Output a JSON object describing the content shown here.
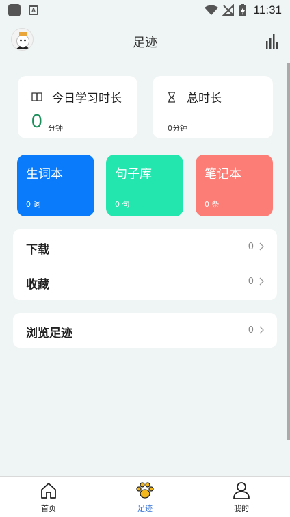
{
  "status_bar": {
    "time": "11:31",
    "a_badge": "A"
  },
  "header": {
    "title": "足迹"
  },
  "time_cards": {
    "today": {
      "title": "今日学习时长",
      "value": "0",
      "unit": "分钟"
    },
    "total": {
      "title": "总时长",
      "value": "0分钟"
    }
  },
  "tiles": [
    {
      "title": "生词本",
      "count": "0 词"
    },
    {
      "title": "句子库",
      "count": "0 句"
    },
    {
      "title": "笔记本",
      "count": "0 条"
    }
  ],
  "list": {
    "download": {
      "label": "下载",
      "count": "0"
    },
    "favorites": {
      "label": "收藏",
      "count": "0"
    },
    "history": {
      "label": "浏览足迹",
      "count": "0"
    }
  },
  "bottom_nav": {
    "home": "首页",
    "footprint": "足迹",
    "mine": "我的"
  },
  "colors": {
    "words_tile": "#0a7bfa",
    "sentences_tile": "#22e6ae",
    "notes_tile": "#fb7d76",
    "today_value": "#1a8f5a",
    "active_nav": "#2f6fd6"
  },
  "icons": {
    "stats": "bar-chart-icon",
    "today": "book-icon",
    "total": "hourglass-icon",
    "home": "home-icon",
    "footprint": "paw-icon",
    "mine": "user-icon"
  }
}
